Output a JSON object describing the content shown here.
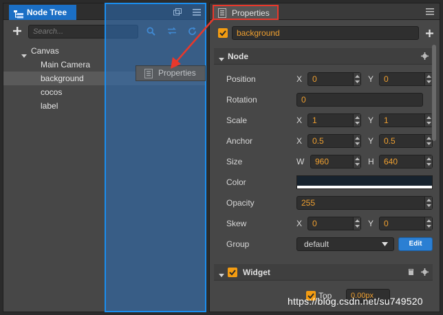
{
  "node_tree": {
    "tab_title": "Node Tree",
    "search_placeholder": "Search...",
    "items": [
      {
        "label": "Canvas",
        "level": 0,
        "expanded": true
      },
      {
        "label": "Main Camera",
        "level": 1
      },
      {
        "label": "background",
        "level": 1,
        "selected": true
      },
      {
        "label": "cocos",
        "level": 1
      },
      {
        "label": "label",
        "level": 1
      }
    ]
  },
  "drag_ghost": {
    "label": "Properties"
  },
  "properties": {
    "tab_title": "Properties",
    "node_name": "background",
    "node_active": true,
    "node_section": {
      "title": "Node",
      "position": {
        "label": "Position",
        "x_axis": "X",
        "x": "0",
        "y_axis": "Y",
        "y": "0"
      },
      "rotation": {
        "label": "Rotation",
        "value": "0"
      },
      "scale": {
        "label": "Scale",
        "x_axis": "X",
        "x": "1",
        "y_axis": "Y",
        "y": "1"
      },
      "anchor": {
        "label": "Anchor",
        "x_axis": "X",
        "x": "0.5",
        "y_axis": "Y",
        "y": "0.5"
      },
      "size": {
        "label": "Size",
        "w_axis": "W",
        "w": "960",
        "h_axis": "H",
        "h": "640"
      },
      "color": {
        "label": "Color",
        "value": "#17232e"
      },
      "opacity": {
        "label": "Opacity",
        "value": "255"
      },
      "skew": {
        "label": "Skew",
        "x_axis": "X",
        "x": "0",
        "y_axis": "Y",
        "y": "0"
      },
      "group": {
        "label": "Group",
        "value": "default",
        "edit_label": "Edit"
      }
    },
    "widget_section": {
      "title": "Widget",
      "enabled": true,
      "top": {
        "label": "Top",
        "value": "0.00px",
        "enabled": true
      }
    }
  },
  "watermark": "https://blog.csdn.net/su749520",
  "colors": {
    "accent_blue": "#1b6fc5",
    "highlight_red": "#e8382b",
    "value_orange": "#f0a030",
    "checkbox_orange": "#f39c12"
  }
}
